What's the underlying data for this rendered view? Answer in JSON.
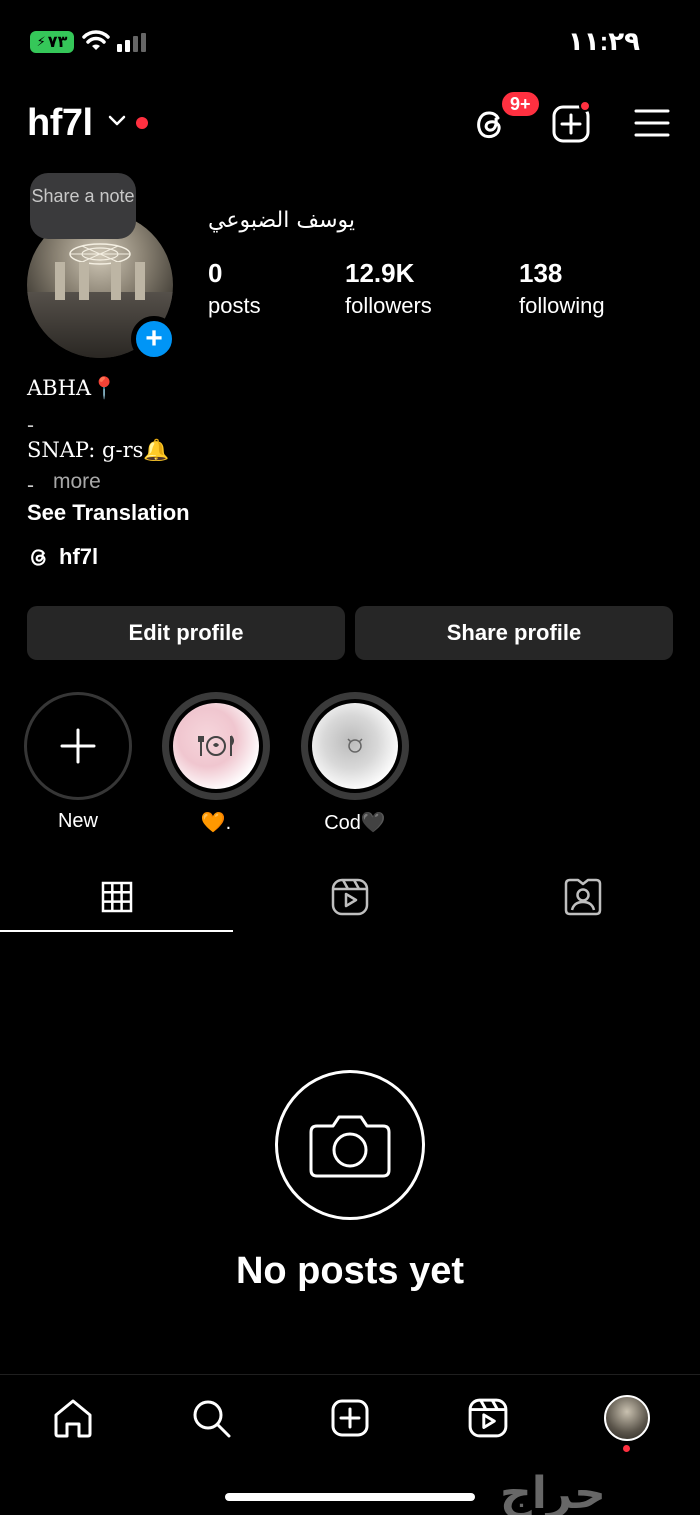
{
  "status_bar": {
    "battery": "٧٣",
    "time": "١١:٢٩"
  },
  "header": {
    "username": "hf7l",
    "threads_badge": "9+",
    "icons": [
      "chevron-down-icon",
      "threads-icon",
      "create-icon",
      "menu-icon"
    ]
  },
  "profile": {
    "note_prompt": "Share a note",
    "display_name": "يوسف الضبوعي",
    "stats": [
      {
        "value": "0",
        "label": "posts"
      },
      {
        "value": "12.9K",
        "label": "followers"
      },
      {
        "value": "138",
        "label": "following"
      }
    ],
    "bio_line1": "ABHA📍",
    "bio_dash1": "-",
    "bio_line2": "SNAP: g-rs🔔",
    "bio_dash2": "-",
    "more": "more",
    "see_translation": "See Translation",
    "threads_handle": "hf7l"
  },
  "actions": {
    "edit_profile": "Edit profile",
    "share_profile": "Share profile"
  },
  "highlights": [
    {
      "label": "New"
    },
    {
      "label": "🧡."
    },
    {
      "label": "Cod🖤"
    }
  ],
  "tabs": [
    "grid-icon",
    "reels-icon",
    "tagged-icon"
  ],
  "empty_state": {
    "title": "No posts yet"
  },
  "bottom_nav": [
    "home-icon",
    "search-icon",
    "create-icon",
    "reels-icon",
    "profile-avatar"
  ],
  "watermark": "حراج",
  "colors": {
    "background": "#000000",
    "accent_blue": "#0095f6",
    "notification_red": "#ff3040",
    "button_gray": "#262626",
    "battery_green": "#35c759"
  }
}
